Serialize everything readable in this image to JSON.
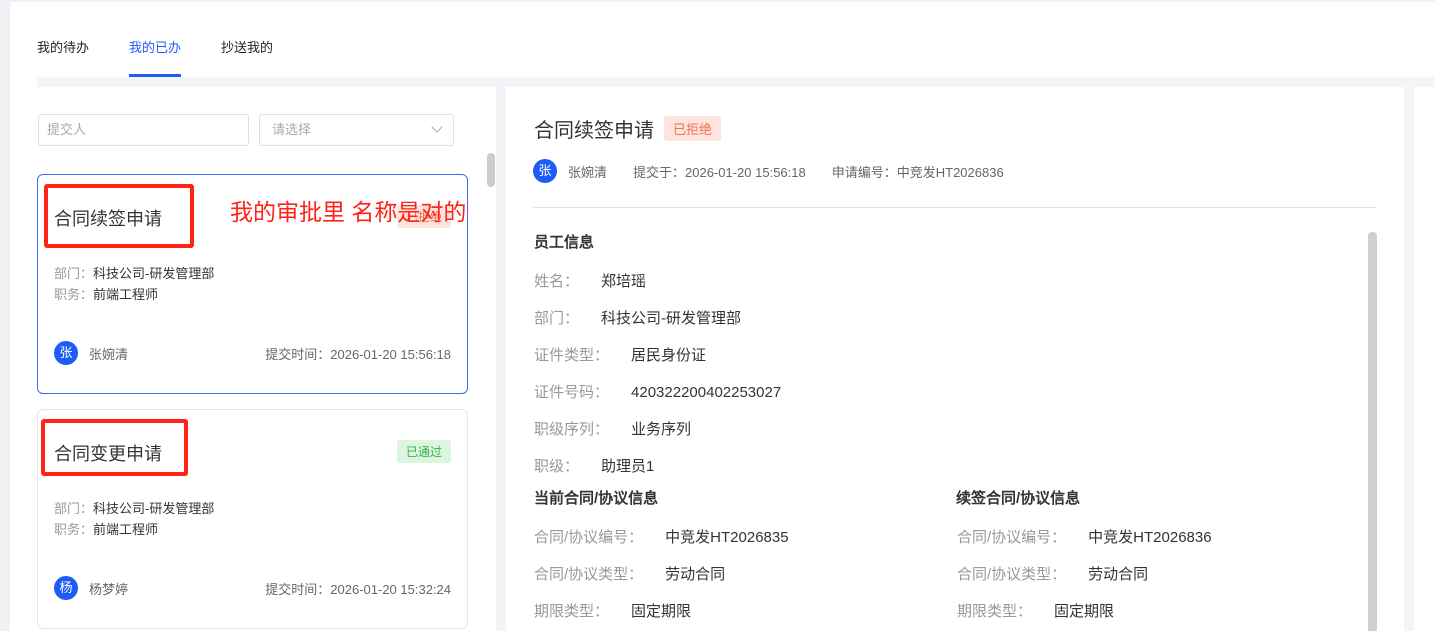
{
  "tabs": [
    {
      "label": "我的待办"
    },
    {
      "label": "我的已办"
    },
    {
      "label": "抄送我的"
    }
  ],
  "active_tab": "我的已办",
  "filters": {
    "submitter_placeholder": "提交人",
    "status_placeholder": "请选择"
  },
  "cards": [
    {
      "title": "合同续签申请",
      "status": "已拒绝",
      "dept_label": "部门：",
      "dept": "科技公司-研发管理部",
      "job_label": "职务：",
      "job": "前端工程师",
      "avatar": "张",
      "name": "张婉清",
      "time_label": "提交时间：",
      "time": "2026-01-20 15:56:18",
      "selected": true
    },
    {
      "title": "合同变更申请",
      "status": "已通过",
      "dept_label": "部门：",
      "dept": "科技公司-研发管理部",
      "job_label": "职务：",
      "job": "前端工程师",
      "avatar": "杨",
      "name": "杨梦婷",
      "time_label": "提交时间：",
      "time": "2026-01-20 15:32:24"
    }
  ],
  "detail": {
    "title": "合同续签申请",
    "status": "已拒绝",
    "avatar": "张",
    "name": "张婉清",
    "submitted": "提交于：2026-01-20 15:56:18",
    "app_no": "申请编号：中竞发HT2026836",
    "employee_section": "员工信息",
    "employee": [
      {
        "label": "姓名：",
        "value": "郑培瑶"
      },
      {
        "label": "部门：",
        "value": "科技公司-研发管理部"
      },
      {
        "label": "证件类型：",
        "value": "居民身份证"
      },
      {
        "label": "证件号码：",
        "value": "420322200402253027"
      },
      {
        "label": "职级序列：",
        "value": "业务序列"
      },
      {
        "label": "职级：",
        "value": "助理员1"
      }
    ],
    "current_section": "当前合同/协议信息",
    "current": [
      {
        "label": "合同/协议编号：",
        "value": "中竞发HT2026835"
      },
      {
        "label": "合同/协议类型：",
        "value": "劳动合同"
      },
      {
        "label": "期限类型：",
        "value": "固定期限"
      }
    ],
    "renew_section": "续签合同/协议信息",
    "renew": [
      {
        "label": "合同/协议编号：",
        "value": "中竞发HT2026836"
      },
      {
        "label": "合同/协议类型：",
        "value": "劳动合同"
      },
      {
        "label": "期限类型：",
        "value": "固定期限"
      }
    ]
  },
  "annotation": {
    "note": "我的审批里 名称是对的",
    "color": "#ff2217"
  },
  "colors": {
    "accent": "#1e5cf5",
    "rejected": "#f2704f",
    "approved": "#35b34a"
  }
}
